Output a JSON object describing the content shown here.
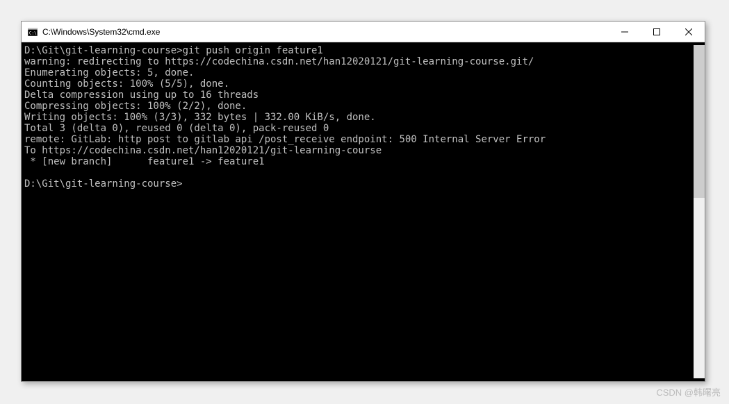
{
  "window": {
    "title": "C:\\Windows\\System32\\cmd.exe"
  },
  "terminal": {
    "lines": [
      "D:\\Git\\git-learning-course>git push origin feature1",
      "warning: redirecting to https://codechina.csdn.net/han12020121/git-learning-course.git/",
      "Enumerating objects: 5, done.",
      "Counting objects: 100% (5/5), done.",
      "Delta compression using up to 16 threads",
      "Compressing objects: 100% (2/2), done.",
      "Writing objects: 100% (3/3), 332 bytes | 332.00 KiB/s, done.",
      "Total 3 (delta 0), reused 0 (delta 0), pack-reused 0",
      "remote: GitLab: http post to gitlab api /post_receive endpoint: 500 Internal Server Error",
      "To https://codechina.csdn.net/han12020121/git-learning-course",
      " * [new branch]      feature1 -> feature1",
      "",
      "D:\\Git\\git-learning-course>"
    ]
  },
  "watermark": "CSDN @韩曙亮"
}
